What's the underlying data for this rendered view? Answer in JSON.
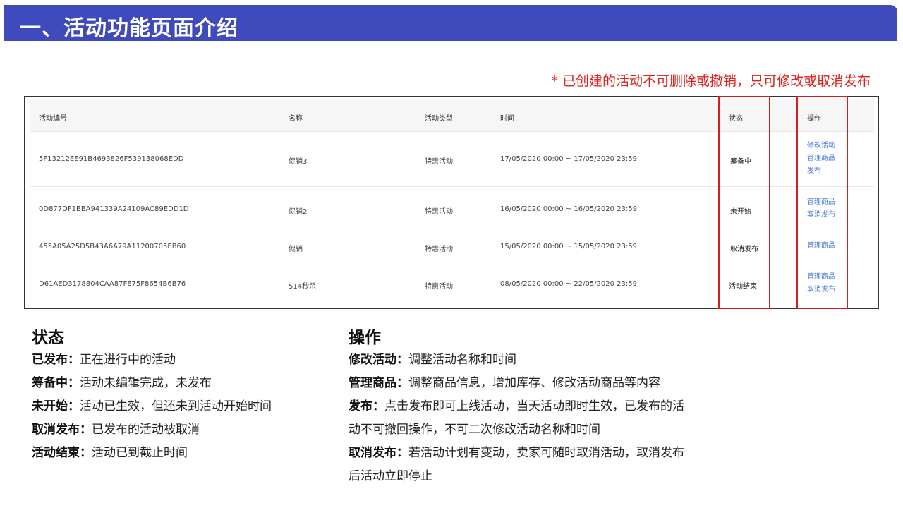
{
  "header": {
    "title": "一、活动功能页面介绍"
  },
  "note": "* 已创建的活动不可删除或撤销，只可修改或取消发布",
  "table": {
    "columns": [
      "活动编号",
      "名称",
      "活动类型",
      "时间",
      "状态",
      "操作"
    ],
    "rows": [
      {
        "id": "5F13212EE91B4693826F539138068EDD",
        "name": "促销3",
        "type": "特惠活动",
        "time": "17/05/2020 00:00 ~ 17/05/2020 23:59",
        "status": "筹备中",
        "actions": [
          "修改活动",
          "管理商品",
          "发布"
        ]
      },
      {
        "id": "0D877DF1BBA941339A24109AC89EDD1D",
        "name": "促销2",
        "type": "特惠活动",
        "time": "16/05/2020 00:00 ~ 16/05/2020 23:59",
        "status": "未开始",
        "actions": [
          "管理商品",
          "取消发布"
        ]
      },
      {
        "id": "455A05A25D5B43A6A79A11200705EB60",
        "name": "促销",
        "type": "特惠活动",
        "time": "15/05/2020 00:00 ~ 15/05/2020 23:59",
        "status": "取消发布",
        "actions": [
          "管理商品"
        ]
      },
      {
        "id": "D61AED3178804CAA87FE75F8654B6B76",
        "name": "514秒杀",
        "type": "特惠活动",
        "time": "08/05/2020 00:00 ~ 22/05/2020 23:59",
        "status": "活动结束",
        "actions": [
          "管理商品",
          "取消发布"
        ]
      }
    ]
  },
  "status_section": {
    "title": "状态",
    "items": [
      {
        "term": "已发布：",
        "desc": "正在进行中的活动"
      },
      {
        "term": "筹备中：",
        "desc": "活动未编辑完成，未发布"
      },
      {
        "term": "未开始：",
        "desc": "活动已生效，但还未到活动开始时间"
      },
      {
        "term": "取消发布：",
        "desc": "已发布的活动被取消"
      },
      {
        "term": "活动结束：",
        "desc": "活动已到截止时间"
      }
    ]
  },
  "ops_section": {
    "title": "操作",
    "items": [
      {
        "term": "修改活动：",
        "desc": "调整活动名称和时间"
      },
      {
        "term": "管理商品：",
        "desc": "调整商品信息，增加库存、修改活动商品等内容"
      },
      {
        "term": "发布：",
        "desc": "点击发布即可上线活动，当天活动即时生效，已发布的活",
        "cont": "动不可撤回操作，不可二次修改活动名称和时间"
      },
      {
        "term": "取消发布：",
        "desc": "若活动计划有变动，卖家可随时取消活动，取消发布",
        "cont": "后活动立即停止"
      }
    ]
  },
  "colors": {
    "title_bar": "#3f4bbd",
    "note": "#e0201b",
    "link": "#4a78e0",
    "highlight": "#d41f1f"
  }
}
